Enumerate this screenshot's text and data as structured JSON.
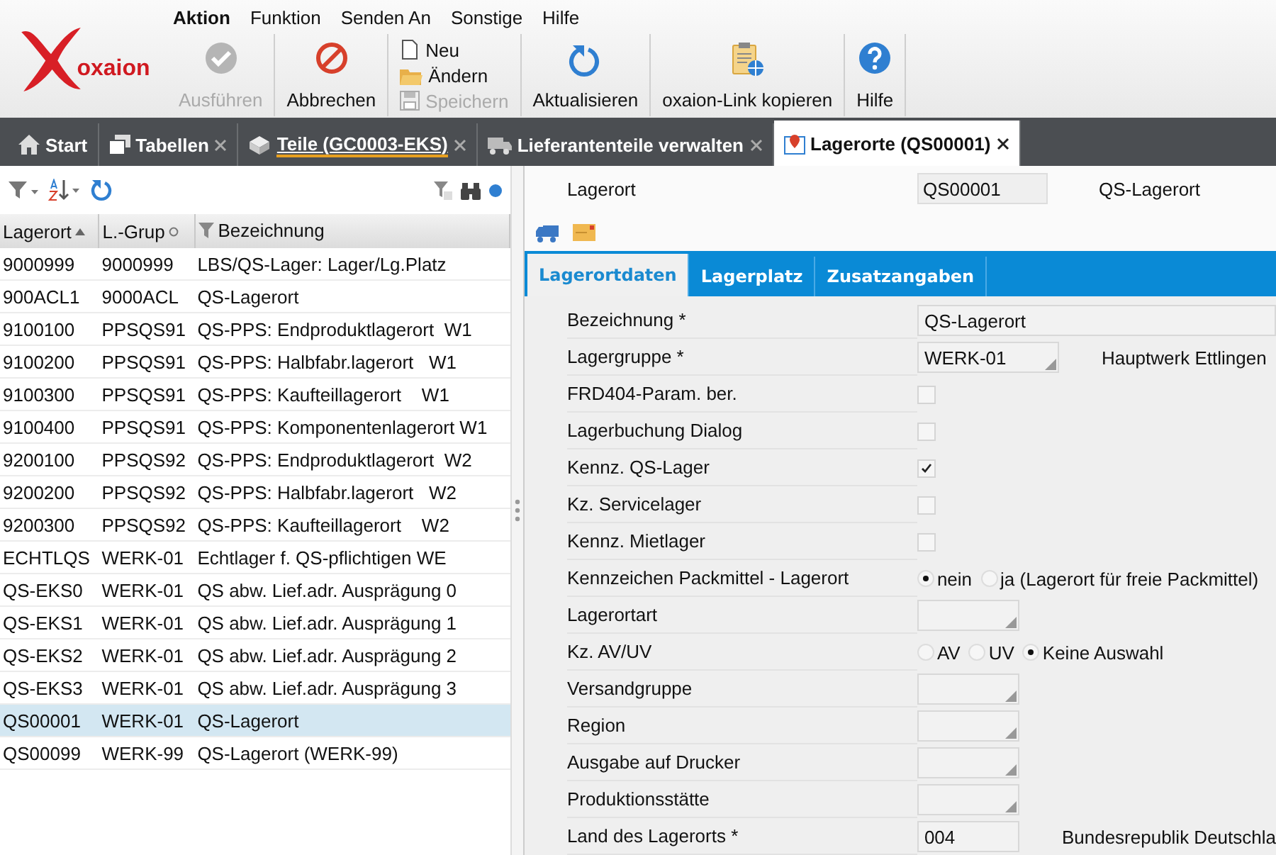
{
  "logo": {
    "text": "oxaion"
  },
  "menu": [
    {
      "label": "Aktion",
      "selected": true
    },
    {
      "label": "Funktion",
      "selected": false
    },
    {
      "label": "Senden An",
      "selected": false
    },
    {
      "label": "Sonstige",
      "selected": false
    },
    {
      "label": "Hilfe",
      "selected": false
    }
  ],
  "toolbar": [
    {
      "kind": "large",
      "label": "Ausführen",
      "disabled": true
    },
    {
      "kind": "large",
      "label": "Abbrechen",
      "disabled": false
    },
    {
      "kind": "stack",
      "items": [
        {
          "label": "Neu",
          "disabled": false
        },
        {
          "label": "Ändern",
          "disabled": false
        },
        {
          "label": "Speichern",
          "disabled": true
        }
      ]
    },
    {
      "kind": "large",
      "label": "Aktualisieren",
      "disabled": false
    },
    {
      "kind": "large",
      "label": "oxaion-Link kopieren",
      "disabled": false
    },
    {
      "kind": "large",
      "label": "Hilfe",
      "disabled": false
    }
  ],
  "tabs": [
    {
      "label": "Start",
      "closable": false,
      "underlined": false,
      "selected": false
    },
    {
      "label": "Tabellen",
      "closable": true,
      "underlined": false,
      "selected": false
    },
    {
      "label": "Teile (GC0003-EKS)",
      "closable": true,
      "underlined": true,
      "selected": false
    },
    {
      "label": "Lieferantenteile verwalten",
      "closable": true,
      "underlined": false,
      "selected": false
    },
    {
      "label": "Lagerorte (QS00001)",
      "closable": true,
      "underlined": false,
      "selected": true
    }
  ],
  "table": {
    "columns": [
      "Lagerort",
      "L.-Grup",
      "Bezeichnung"
    ],
    "rows": [
      {
        "cells": [
          "9000999",
          "9000999",
          "LBS/QS-Lager: Lager/Lg.Platz"
        ],
        "selected": false
      },
      {
        "cells": [
          "900ACL1",
          "9000ACL",
          "QS-Lagerort"
        ],
        "selected": false
      },
      {
        "cells": [
          "9100100",
          "PPSQS91",
          "QS-PPS: Endproduktlagerort  W1"
        ],
        "selected": false
      },
      {
        "cells": [
          "9100200",
          "PPSQS91",
          "QS-PPS: Halbfabr.lagerort   W1"
        ],
        "selected": false
      },
      {
        "cells": [
          "9100300",
          "PPSQS91",
          "QS-PPS: Kaufteillagerort    W1"
        ],
        "selected": false
      },
      {
        "cells": [
          "9100400",
          "PPSQS91",
          "QS-PPS: Komponentenlagerort W1"
        ],
        "selected": false
      },
      {
        "cells": [
          "9200100",
          "PPSQS92",
          "QS-PPS: Endproduktlagerort  W2"
        ],
        "selected": false
      },
      {
        "cells": [
          "9200200",
          "PPSQS92",
          "QS-PPS: Halbfabr.lagerort   W2"
        ],
        "selected": false
      },
      {
        "cells": [
          "9200300",
          "PPSQS92",
          "QS-PPS: Kaufteillagerort    W2"
        ],
        "selected": false
      },
      {
        "cells": [
          "ECHTLQS",
          "WERK-01",
          "Echtlager f. QS-pflichtigen WE"
        ],
        "selected": false
      },
      {
        "cells": [
          "QS-EKS0",
          "WERK-01",
          "QS abw. Lief.adr. Ausprägung 0"
        ],
        "selected": false
      },
      {
        "cells": [
          "QS-EKS1",
          "WERK-01",
          "QS abw. Lief.adr. Ausprägung 1"
        ],
        "selected": false
      },
      {
        "cells": [
          "QS-EKS2",
          "WERK-01",
          "QS abw. Lief.adr. Ausprägung 2"
        ],
        "selected": false
      },
      {
        "cells": [
          "QS-EKS3",
          "WERK-01",
          "QS abw. Lief.adr. Ausprägung 3"
        ],
        "selected": false
      },
      {
        "cells": [
          "QS00001",
          "WERK-01",
          "QS-Lagerort"
        ],
        "selected": true
      },
      {
        "cells": [
          "QS00099",
          "WERK-99",
          "QS-Lagerort (WERK-99)"
        ],
        "selected": false
      }
    ]
  },
  "header": {
    "label": "Lagerort",
    "value": "QS00001",
    "description": "QS-Lagerort"
  },
  "detail_tabs": [
    {
      "label": "Lagerortdaten",
      "selected": true
    },
    {
      "label": "Lagerplatz",
      "selected": false
    },
    {
      "label": "Zusatzangaben",
      "selected": false
    }
  ],
  "form": [
    {
      "kind": "text",
      "label": "Bezeichnung *",
      "value": "QS-Lagerort"
    },
    {
      "kind": "combo",
      "label": "Lagergruppe *",
      "value": "WERK-01",
      "extra": "Hauptwerk Ettlingen"
    },
    {
      "kind": "checkbox",
      "label": "FRD404-Param. ber.",
      "checked": false
    },
    {
      "kind": "checkbox",
      "label": "Lagerbuchung Dialog",
      "checked": false
    },
    {
      "kind": "checkbox",
      "label": "Kennz. QS-Lager",
      "checked": true
    },
    {
      "kind": "checkbox",
      "label": "Kz. Servicelager",
      "checked": false
    },
    {
      "kind": "checkbox",
      "label": "Kennz. Mietlager",
      "checked": false
    },
    {
      "kind": "radio",
      "label": "Kennzeichen Packmittel - Lagerort",
      "options": [
        {
          "label": "nein",
          "selected": true
        },
        {
          "label": "ja (Lagerort für freie Packmittel)",
          "selected": false
        }
      ]
    },
    {
      "kind": "combo",
      "label": "Lagerortart"
    },
    {
      "kind": "radio",
      "label": "Kz. AV/UV",
      "options": [
        {
          "label": "AV",
          "selected": false
        },
        {
          "label": "UV",
          "selected": false
        },
        {
          "label": "Keine Auswahl",
          "selected": true
        }
      ]
    },
    {
      "kind": "combo",
      "label": "Versandgruppe"
    },
    {
      "kind": "combo",
      "label": "Region"
    },
    {
      "kind": "combo",
      "label": "Ausgabe auf Drucker"
    },
    {
      "kind": "combo",
      "label": "Produktionsstätte"
    },
    {
      "kind": "text",
      "label": "Land des Lagerorts *",
      "value": "004",
      "extra": "Bundesrepublik Deutschla"
    }
  ]
}
